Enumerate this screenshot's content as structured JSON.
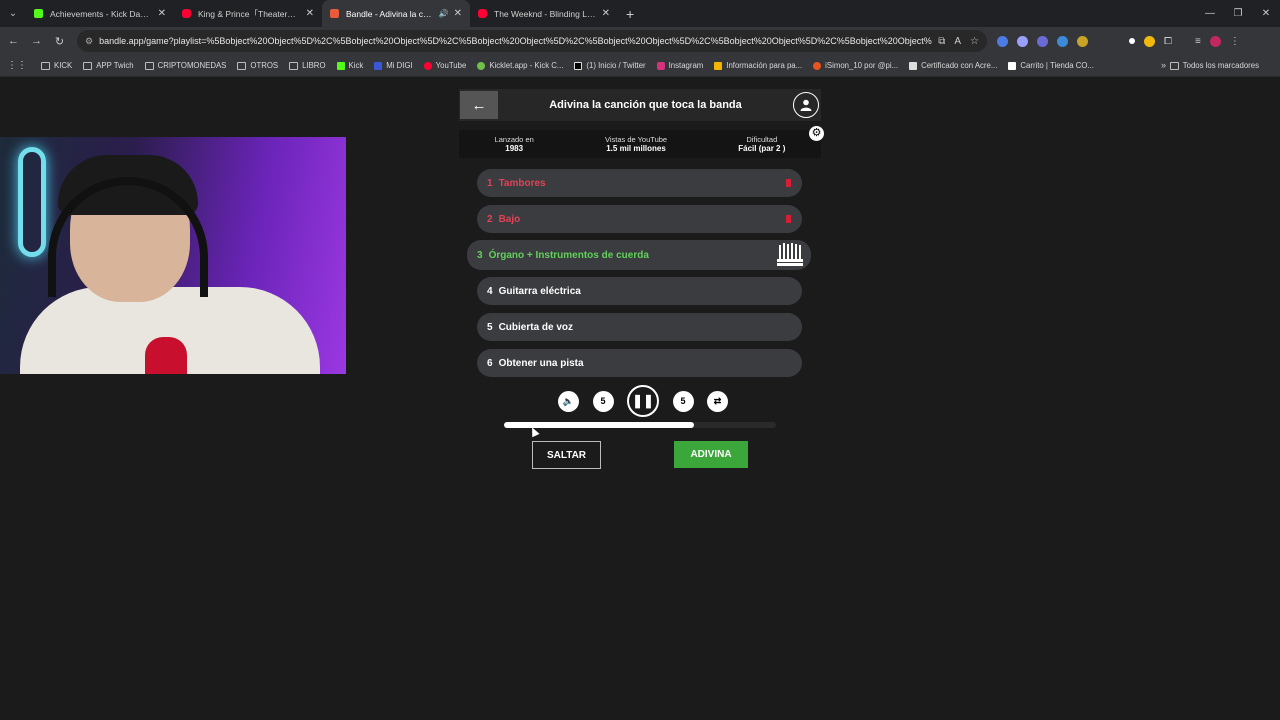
{
  "browser": {
    "tabs": [
      {
        "title": "Achievements - Kick Dashboard",
        "color": "#53fc18",
        "active": false
      },
      {
        "title": "King & Prince「Theater」MV - Yo",
        "color": "#ff0033",
        "active": false
      },
      {
        "title": "Bandle - Adivina la canción",
        "color": "#e85a3c",
        "active": true
      },
      {
        "title": "The Weeknd - Blinding Lights (",
        "color": "#ff0033",
        "active": false
      }
    ],
    "url": "bandle.app/game?playlist=%5Bobject%20Object%5D%2C%5Bobject%20Object%5D%2C%5Bobject%20Object%5D%2C%5Bobject%20Object%5D%2C%5Bobject%20Object%5D%2C%5Bobject%20Object%5D",
    "bookmarks": [
      "KICK",
      "APP Twich",
      "CRIPTOMONEDAS",
      "OTROS",
      "LIBRO",
      "Kick",
      "Mi DIGI",
      "YouTube",
      "Kicklet.app - Kick C...",
      "(1) Inicio / Twitter",
      "Instagram",
      "Información para pa...",
      "iSimon_10 por @pi...",
      "Certificado con Acre...",
      "Carrito | Tienda CO..."
    ],
    "all_bookmarks": "Todos los marcadores"
  },
  "game": {
    "title": "Adivina la canción que toca la banda",
    "stats": [
      {
        "label": "Lanzado en",
        "value": "1983"
      },
      {
        "label": "Vistas de YouTube",
        "value": "1.5 mil millones"
      },
      {
        "label": "Dificultad",
        "value": "Fácil (par 2 )"
      }
    ],
    "tracks": [
      {
        "num": "1",
        "label": "Tambores",
        "state": "wrong"
      },
      {
        "num": "2",
        "label": "Bajo",
        "state": "wrong"
      },
      {
        "num": "3",
        "label": "Órgano + Instrumentos de cuerda",
        "state": "current"
      },
      {
        "num": "4",
        "label": "Guitarra eléctrica",
        "state": "locked"
      },
      {
        "num": "5",
        "label": "Cubierta de voz",
        "state": "locked"
      },
      {
        "num": "6",
        "label": "Obtener una pista",
        "state": "locked"
      }
    ],
    "rewind_label": "5",
    "forward_label": "5",
    "progress": 0.7,
    "skip_label": "SALTAR",
    "guess_label": "ADIVINA",
    "colors": {
      "correct": "#62d15a",
      "wrong": "#e04356",
      "guess_button": "#3ba63a"
    }
  }
}
